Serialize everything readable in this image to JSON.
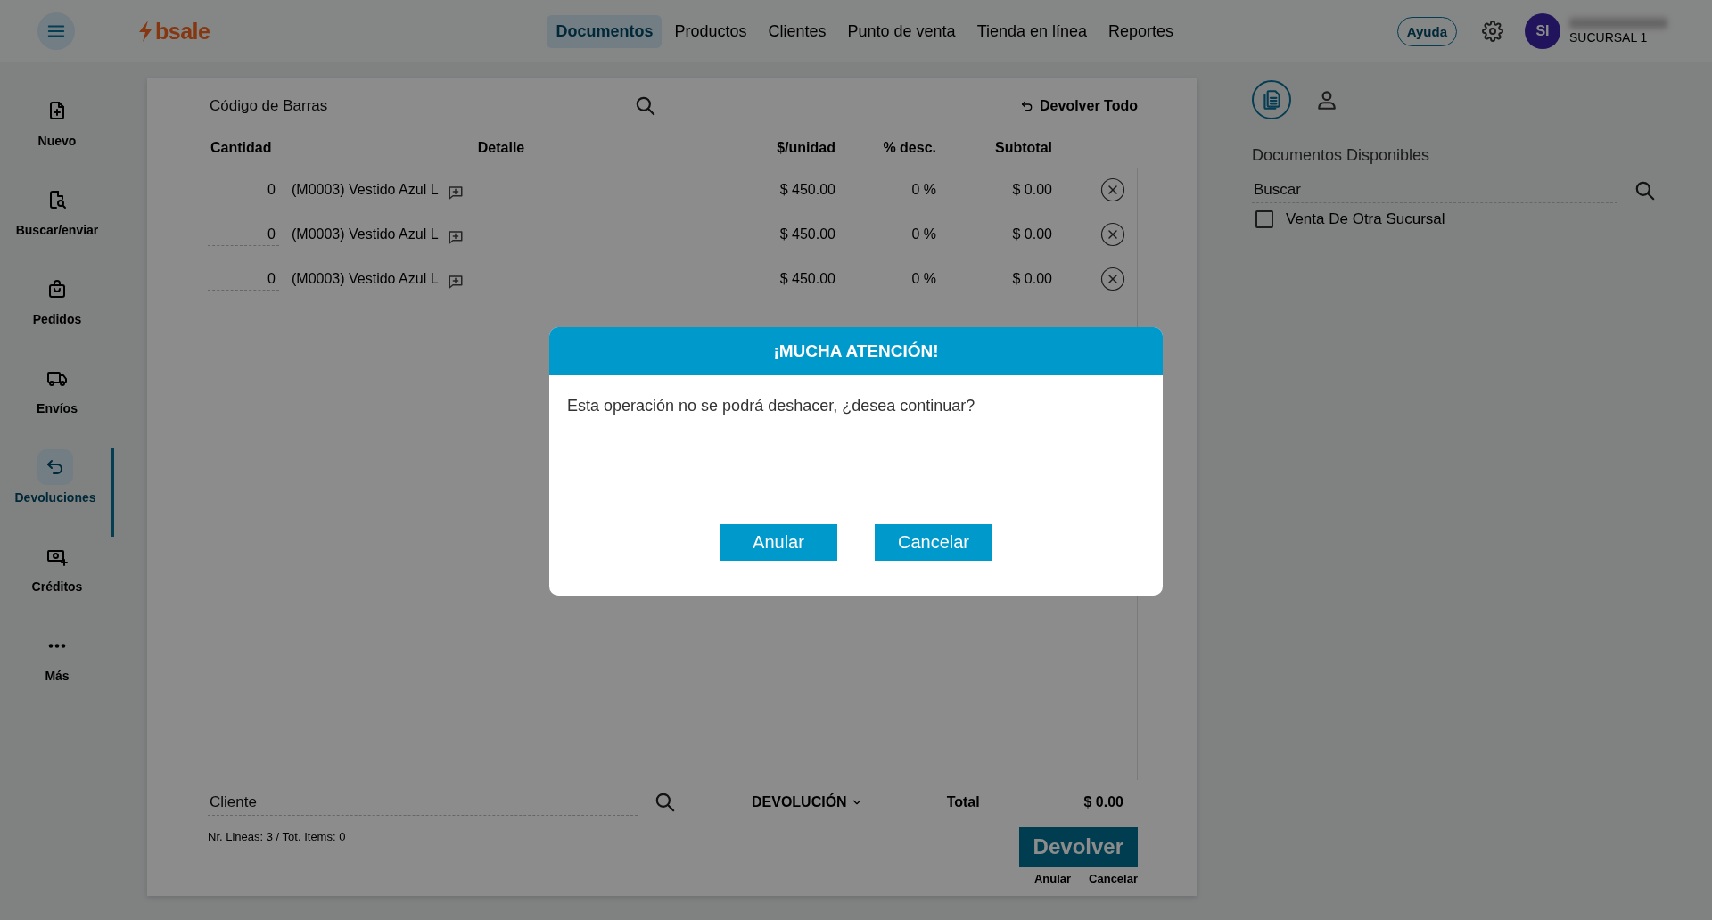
{
  "topbar": {
    "logo": "bsale",
    "nav": [
      {
        "label": "Documentos",
        "selected": true
      },
      {
        "label": "Productos",
        "selected": false
      },
      {
        "label": "Clientes",
        "selected": false
      },
      {
        "label": "Punto de venta",
        "selected": false
      },
      {
        "label": "Tienda en línea",
        "selected": false
      },
      {
        "label": "Reportes",
        "selected": false
      }
    ],
    "help": "Ayuda",
    "avatar": "SI",
    "branch": "SUCURSAL 1"
  },
  "sidebar": {
    "items": [
      {
        "label": "Nuevo",
        "selected": false
      },
      {
        "label": "Buscar/enviar",
        "selected": false
      },
      {
        "label": "Pedidos",
        "selected": false
      },
      {
        "label": "Envíos",
        "selected": false
      },
      {
        "label": "Devoluciones",
        "selected": true
      },
      {
        "label": "Créditos",
        "selected": false
      },
      {
        "label": "Más",
        "selected": false
      }
    ]
  },
  "main": {
    "barcode_field": {
      "placeholder": "Código de Barras"
    },
    "return_all": "Devolver Todo",
    "columns": [
      "Cantidad",
      "Detalle",
      "$/unidad",
      "% desc.",
      "Subtotal"
    ],
    "rows": [
      {
        "quantity": "0",
        "detail": "(M0003) Vestido Azul L",
        "unit_price": "$ 450.00",
        "discount": "0 %",
        "subtotal": "$ 0.00"
      },
      {
        "quantity": "0",
        "detail": "(M0003) Vestido Azul L",
        "unit_price": "$ 450.00",
        "discount": "0 %",
        "subtotal": "$ 0.00"
      },
      {
        "quantity": "0",
        "detail": "(M0003) Vestido Azul L",
        "unit_price": "$ 450.00",
        "discount": "0 %",
        "subtotal": "$ 0.00"
      }
    ],
    "customer_field": {
      "placeholder": "Cliente"
    },
    "document_type": "DEVOLUCIÓN",
    "total_label": "Total",
    "total": "$ 0.00",
    "summary": "Nr. Lineas: 3 / Tot. Items: 0",
    "primary_button": "Devolver",
    "links": [
      "Anular",
      "Cancelar"
    ]
  },
  "right_panel": {
    "tabs": [
      {
        "selected": true
      },
      {
        "selected": false
      }
    ],
    "heading": "Documentos Disponibles",
    "search_field": {
      "placeholder": "Buscar"
    },
    "option": {
      "label": "Venta De Otra Sucursal",
      "checked": false
    }
  },
  "dialog": {
    "title": "¡MUCHA ATENCIÓN!",
    "message": "Esta operación no se podrá deshacer, ¿desea continuar?",
    "buttons": [
      "Anular",
      "Cancelar"
    ]
  }
}
